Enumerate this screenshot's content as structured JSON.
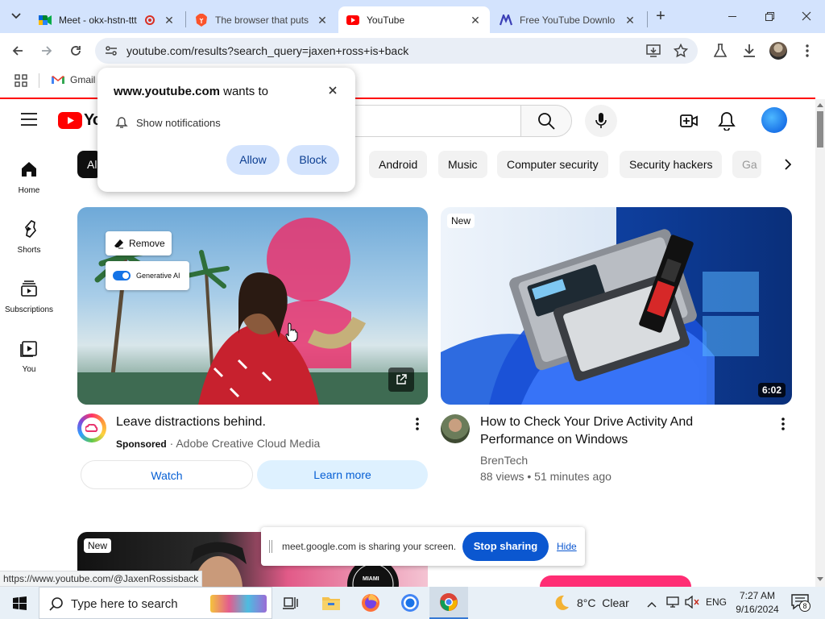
{
  "tabs": [
    {
      "title": "Meet - okx-hstn-ttt",
      "active": false
    },
    {
      "title": "The browser that puts",
      "active": false
    },
    {
      "title": "YouTube",
      "active": true
    },
    {
      "title": "Free YouTube Downlo",
      "active": false
    }
  ],
  "address_bar": {
    "url": "youtube.com/results?search_query=jaxen+ross+is+back"
  },
  "bookmarks": [
    {
      "label": "Gmail"
    }
  ],
  "notification_popup": {
    "site": "www.youtube.com",
    "suffix": "wants to",
    "permission": "Show notifications",
    "allow_label": "Allow",
    "block_label": "Block"
  },
  "youtube": {
    "logo_text": "YouTube",
    "chips": [
      "All",
      "Android",
      "Music",
      "Computer security",
      "Security hackers",
      "Ga"
    ],
    "sidebar": [
      {
        "label": "Home",
        "icon": "home-icon"
      },
      {
        "label": "Shorts",
        "icon": "shorts-icon"
      },
      {
        "label": "Subscriptions",
        "icon": "subscriptions-icon"
      },
      {
        "label": "You",
        "icon": "you-icon"
      }
    ],
    "ad_card": {
      "title": "Leave distractions behind.",
      "sponsored": "Sponsored",
      "advertiser": "Adobe Creative Cloud Media",
      "watch_label": "Watch",
      "learn_label": "Learn more",
      "overlay_remove": "Remove",
      "overlay_genai": "Generative AI"
    },
    "video_card": {
      "badge": "New",
      "duration": "6:02",
      "title_line1": "How to Check Your Drive Activity And",
      "title_line2": "Performance on Windows",
      "channel": "BrenTech",
      "views": "88 views",
      "age": "51 minutes ago"
    },
    "next_card": {
      "badge": "New",
      "logo_text": "MIAMI"
    }
  },
  "share_bar": {
    "message": "meet.google.com is sharing your screen.",
    "stop_label": "Stop sharing",
    "hide_label": "Hide"
  },
  "status_url": "https://www.youtube.com/@JaxenRossisback",
  "taskbar": {
    "search_placeholder": "Type here to search",
    "weather": "8°C  Clear",
    "lang": "ENG",
    "time": "7:27 AM",
    "date": "9/16/2024",
    "notif_count": "8"
  },
  "colors": {
    "yt_red": "#ff0000",
    "tab_strip": "#d3e3fd",
    "stop_button": "#0b57d0"
  }
}
